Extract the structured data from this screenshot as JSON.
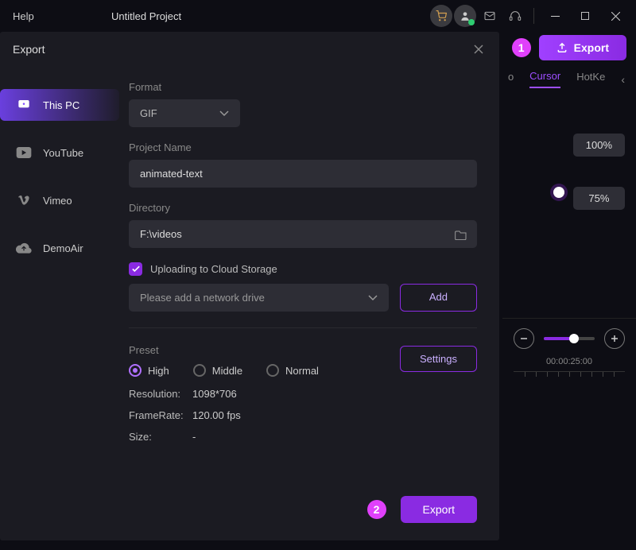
{
  "titlebar": {
    "help": "Help",
    "project": "Untitled Project"
  },
  "top": {
    "export_label": "Export",
    "annot1": "1"
  },
  "bg_tabs": {
    "tab1": "o",
    "tab2": "Cursor",
    "tab3": "HotKe"
  },
  "bg_right": {
    "pill1": "100%",
    "pill2": "75%"
  },
  "timeline": {
    "time": "00:00:25:00"
  },
  "modal": {
    "title": "Export",
    "sidebar": {
      "this_pc": "This PC",
      "youtube": "YouTube",
      "vimeo": "Vimeo",
      "demoair": "DemoAir"
    },
    "form": {
      "format_label": "Format",
      "format_value": "GIF",
      "project_label": "Project Name",
      "project_value": "animated-text",
      "directory_label": "Directory",
      "directory_value": "F:\\videos",
      "cloud_label": "Uploading to Cloud Storage",
      "network_placeholder": "Please add a network drive",
      "add_btn": "Add",
      "preset_label": "Preset",
      "settings_btn": "Settings",
      "radio_high": "High",
      "radio_middle": "Middle",
      "radio_normal": "Normal",
      "resolution_k": "Resolution:",
      "resolution_v": "1098*706",
      "framerate_k": "FrameRate:",
      "framerate_v": "120.00 fps",
      "size_k": "Size:",
      "size_v": "-",
      "export_btn": "Export",
      "annot2": "2"
    }
  }
}
